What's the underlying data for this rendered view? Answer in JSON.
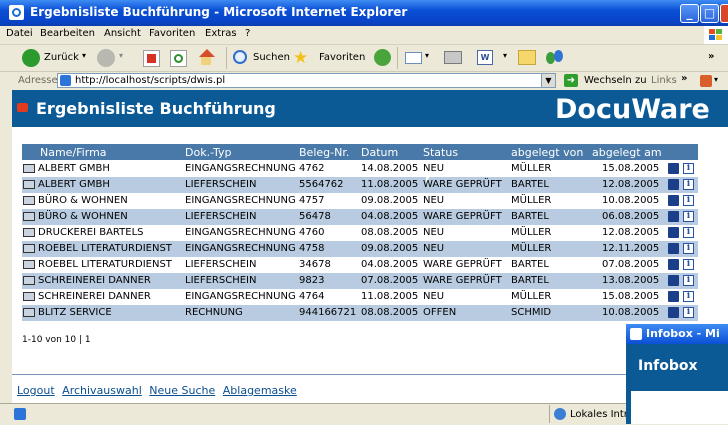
{
  "window": {
    "title": "Ergebnisliste Buchführung - Microsoft Internet Explorer"
  },
  "menu": [
    "Datei",
    "Bearbeiten",
    "Ansicht",
    "Favoriten",
    "Extras",
    "?"
  ],
  "toolbar": {
    "back": "Zurück",
    "search": "Suchen",
    "favorites": "Favoriten"
  },
  "address": {
    "label": "Adresse",
    "url": "http://localhost/scripts/dwis.pl",
    "go": "Wechseln zu",
    "links": "Links"
  },
  "page": {
    "title": "Ergebnisliste Buchführung",
    "logo": "DocuWare",
    "columns": [
      "Name/Firma",
      "Dok.-Typ",
      "Beleg-Nr.",
      "Datum",
      "Status",
      "abgelegt von",
      "abgelegt am"
    ],
    "rows": [
      {
        "name": "ALBERT GMBH",
        "typ": "EINGANGSRECHNUNG",
        "nr": "4762",
        "datum": "14.08.2005",
        "status": "NEU",
        "von": "MÜLLER",
        "am": "15.08.2005"
      },
      {
        "name": "ALBERT GMBH",
        "typ": "LIEFERSCHEIN",
        "nr": "5564762",
        "datum": "11.08.2005",
        "status": "WARE GEPRÜFT",
        "von": "BARTEL",
        "am": "12.08.2005"
      },
      {
        "name": "BÜRO & WOHNEN",
        "typ": "EINGANGSRECHNUNG",
        "nr": "4757",
        "datum": "09.08.2005",
        "status": "NEU",
        "von": "MÜLLER",
        "am": "10.08.2005"
      },
      {
        "name": "BÜRO & WOHNEN",
        "typ": "LIEFERSCHEIN",
        "nr": "56478",
        "datum": "04.08.2005",
        "status": "WARE GEPRÜFT",
        "von": "BARTEL",
        "am": "06.08.2005"
      },
      {
        "name": "DRUCKEREI BARTELS",
        "typ": "EINGANGSRECHNUNG",
        "nr": "4760",
        "datum": "08.08.2005",
        "status": "NEU",
        "von": "MÜLLER",
        "am": "12.08.2005"
      },
      {
        "name": "ROEBEL LITERATURDIENST",
        "typ": "EINGANGSRECHNUNG",
        "nr": "4758",
        "datum": "09.08.2005",
        "status": "NEU",
        "von": "MÜLLER",
        "am": "12.11.2005"
      },
      {
        "name": "ROEBEL LITERATURDIENST",
        "typ": "LIEFERSCHEIN",
        "nr": "34678",
        "datum": "04.08.2005",
        "status": "WARE GEPRÜFT",
        "von": "BARTEL",
        "am": "07.08.2005"
      },
      {
        "name": "SCHREINEREI DANNER",
        "typ": "LIEFERSCHEIN",
        "nr": "9823",
        "datum": "07.08.2005",
        "status": "WARE GEPRÜFT",
        "von": "BARTEL",
        "am": "13.08.2005"
      },
      {
        "name": "SCHREINEREI DANNER",
        "typ": "EINGANGSRECHNUNG",
        "nr": "4764",
        "datum": "11.08.2005",
        "status": "NEU",
        "von": "MÜLLER",
        "am": "15.08.2005"
      },
      {
        "name": "BLITZ SERVICE",
        "typ": "RECHNUNG",
        "nr": "944166721",
        "datum": "08.08.2005",
        "status": "OFFEN",
        "von": "SCHMID",
        "am": "10.08.2005"
      }
    ],
    "pager": "1-10 von 10 | 1",
    "links": [
      "Logout",
      "Archivauswahl",
      "Neue Suche",
      "Ablagemaske"
    ]
  },
  "status": {
    "zone": "Lokales Intra"
  },
  "infobox": {
    "window_title": "Infobox - Mi",
    "heading": "Infobox"
  },
  "colors": {
    "banner": "#0b5a96",
    "header_row": "#4979a8",
    "alt_row": "#b9cbe0"
  }
}
